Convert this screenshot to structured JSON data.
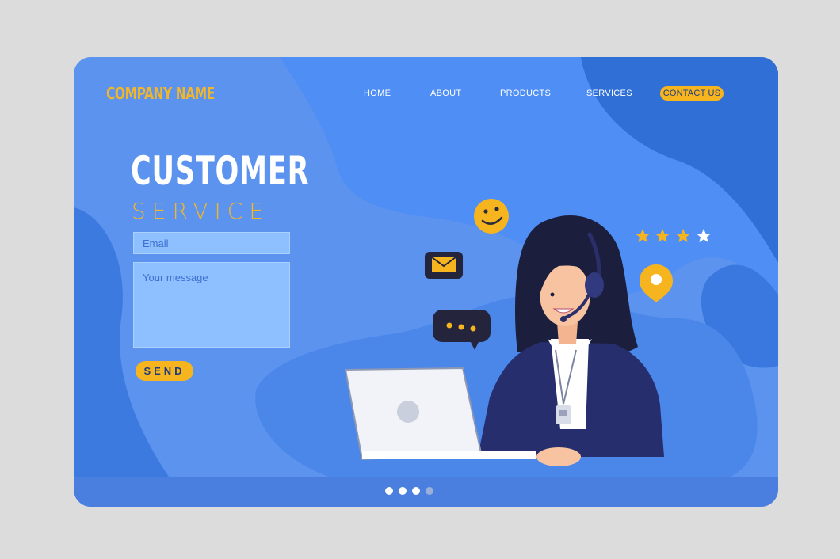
{
  "header": {
    "brand": "COMPANY NAME",
    "nav": [
      "HOME",
      "ABOUT",
      "PRODUCTS",
      "SERVICES"
    ],
    "cta": "CONTACT US"
  },
  "hero": {
    "title": "CUSTOMER",
    "subtitle": "SERVICE"
  },
  "form": {
    "email_placeholder": "Email",
    "message_placeholder": "Your message",
    "send_label": "SEND"
  },
  "rating": {
    "value": 3,
    "max": 4
  },
  "carousel": {
    "count": 4,
    "active": [
      1,
      2,
      3
    ]
  },
  "colors": {
    "accent": "#f6b51f",
    "brand_text": "#f2b62a",
    "background": "#5b93ee",
    "card_dark": "#2a63d0",
    "suit": "#262e6e"
  },
  "icons": [
    "smiley-icon",
    "envelope-icon",
    "chat-bubble-icon",
    "star-icon",
    "location-pin-icon",
    "headset-icon",
    "laptop-icon"
  ]
}
